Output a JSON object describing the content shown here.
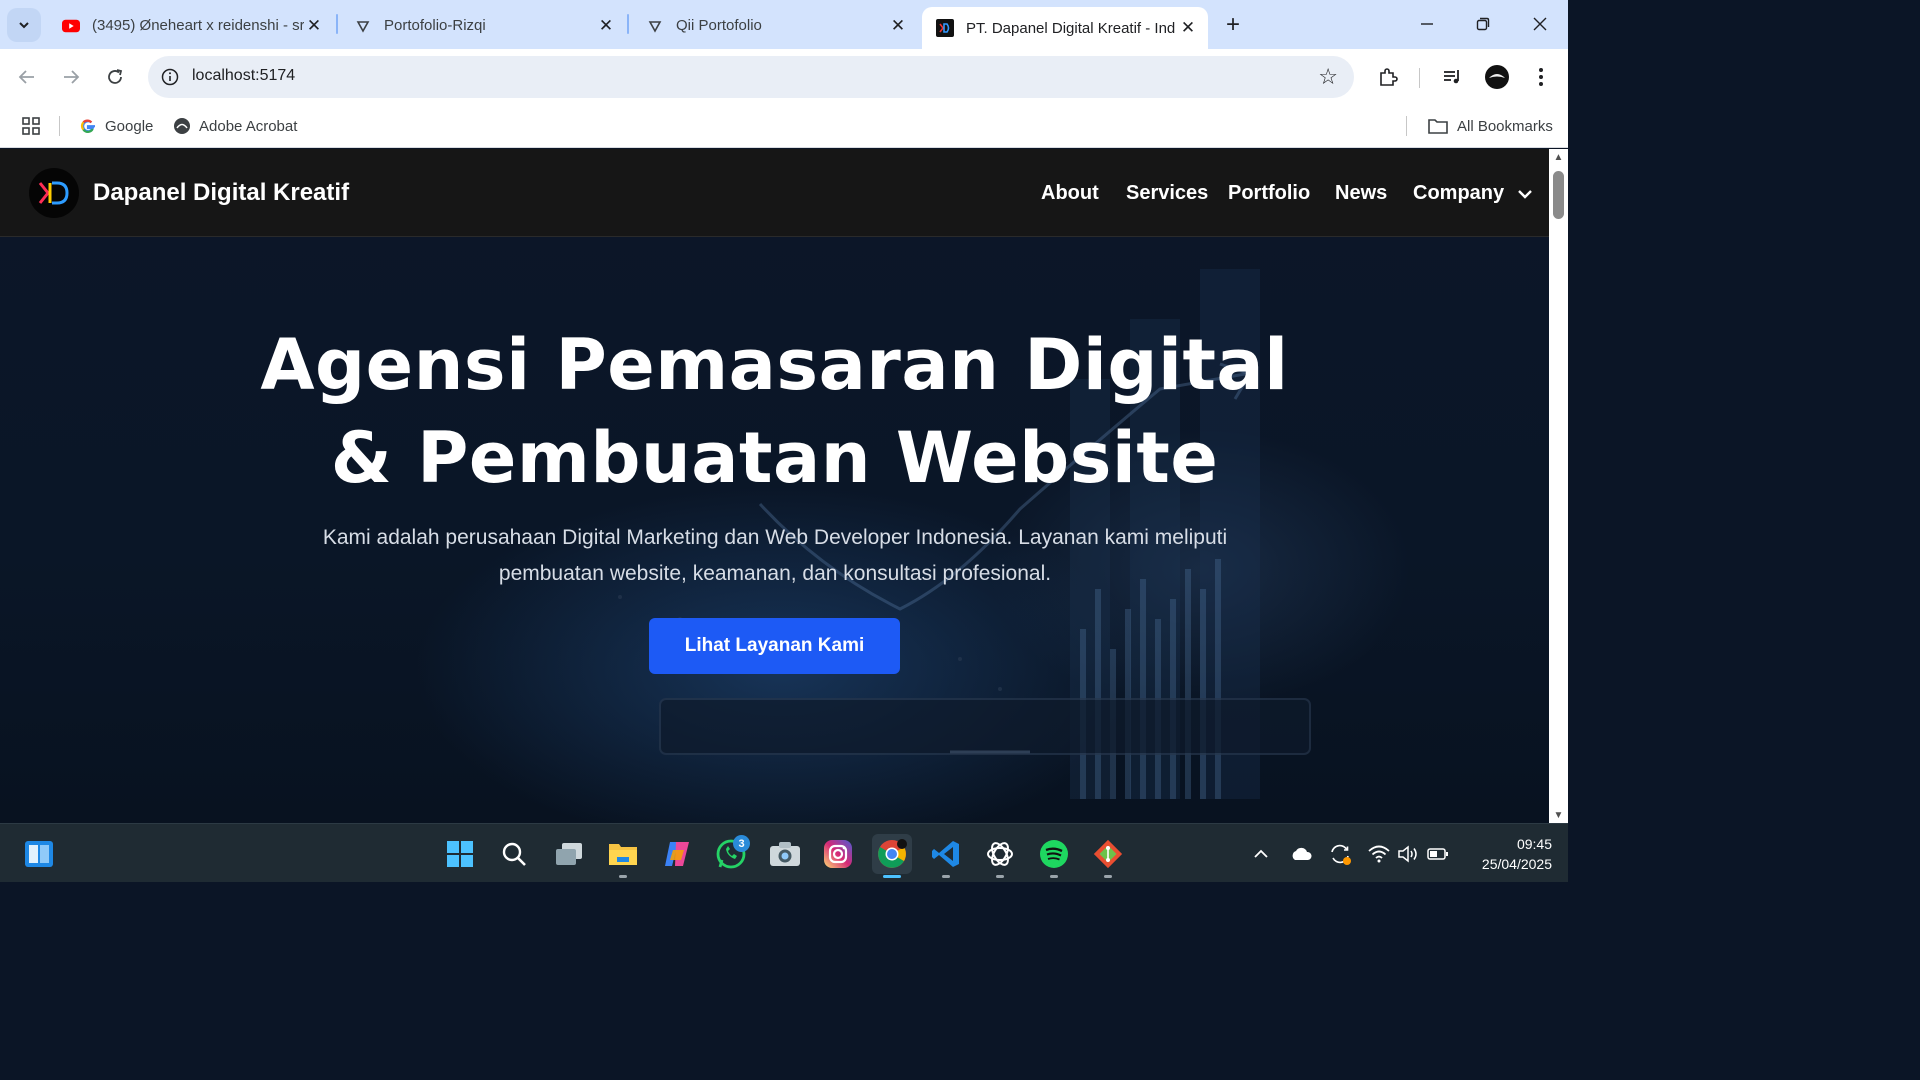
{
  "browser": {
    "tabs": [
      {
        "title": "(3495) Øneheart x reidenshi - sr",
        "favicon": "youtube-icon"
      },
      {
        "title": "Portofolio-Rizqi",
        "favicon": "vite-icon"
      },
      {
        "title": "Qii Portofolio",
        "favicon": "vite-icon"
      },
      {
        "title": "PT. Dapanel Digital Kreatif - Ind",
        "favicon": "dapanel-icon"
      }
    ],
    "url": "localhost:5174",
    "bookmarks": [
      {
        "label": "Google",
        "icon": "google-icon"
      },
      {
        "label": "Adobe Acrobat",
        "icon": "acrobat-icon"
      }
    ],
    "all_bookmarks_label": "All Bookmarks"
  },
  "site": {
    "brand": "Dapanel Digital Kreatif",
    "logo_text": "KD",
    "nav": [
      "About",
      "Services",
      "Portfolio",
      "News",
      "Company"
    ],
    "hero": {
      "title_line1": "Agensi Pemasaran Digital",
      "title_line2": "& Pembuatan Website",
      "subtitle_line1": "Kami adalah perusahaan Digital Marketing dan Web Developer Indonesia. Layanan kami meliputi",
      "subtitle_line2": "pembuatan website, keamanan, dan konsultasi profesional.",
      "cta": "Lihat Layanan Kami"
    },
    "colors": {
      "cta": "#1d5af5",
      "nav_bg": "#161616",
      "hero_bg": "#0b1526"
    }
  },
  "taskbar": {
    "apps": [
      "widgets-icon",
      "windows-start-icon",
      "search-icon",
      "task-view-icon",
      "file-explorer-icon",
      "copilot-icon",
      "whatsapp-icon",
      "camera-icon",
      "instagram-icon",
      "chrome-icon",
      "vscode-icon",
      "chatgpt-icon",
      "spotify-icon",
      "git-icon"
    ],
    "whatsapp_badge": "3",
    "time": "09:45",
    "date": "25/04/2025"
  }
}
